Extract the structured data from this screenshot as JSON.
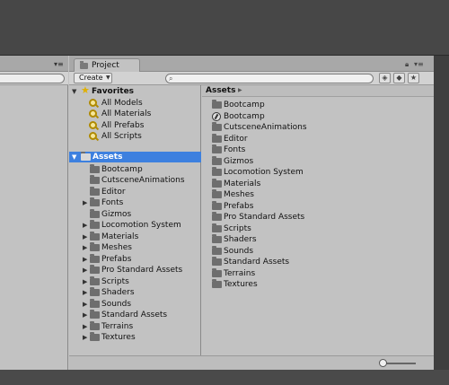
{
  "project_window": {
    "tab_label": "Project",
    "lock_icon": "lock-icon",
    "menu_icon": "menu-icon",
    "create_label": "Create",
    "search_value": "",
    "toolbar_icons": [
      "filter-type-icon",
      "filter-label-icon",
      "star-icon"
    ]
  },
  "tree": {
    "favorites": {
      "label": "Favorites",
      "items": [
        "All Models",
        "All Materials",
        "All Prefabs",
        "All Scripts"
      ]
    },
    "assets": {
      "label": "Assets",
      "children": [
        {
          "label": "Bootcamp",
          "expandable": false
        },
        {
          "label": "CutsceneAnimations",
          "expandable": false
        },
        {
          "label": "Editor",
          "expandable": false
        },
        {
          "label": "Fonts",
          "expandable": true
        },
        {
          "label": "Gizmos",
          "expandable": false
        },
        {
          "label": "Locomotion System",
          "expandable": true
        },
        {
          "label": "Materials",
          "expandable": true
        },
        {
          "label": "Meshes",
          "expandable": true
        },
        {
          "label": "Prefabs",
          "expandable": true
        },
        {
          "label": "Pro Standard Assets",
          "expandable": true
        },
        {
          "label": "Scripts",
          "expandable": true
        },
        {
          "label": "Shaders",
          "expandable": true
        },
        {
          "label": "Sounds",
          "expandable": true
        },
        {
          "label": "Standard Assets",
          "expandable": true
        },
        {
          "label": "Terrains",
          "expandable": true
        },
        {
          "label": "Textures",
          "expandable": true
        }
      ]
    }
  },
  "content": {
    "breadcrumb": "Assets",
    "items": [
      {
        "label": "Bootcamp",
        "icon": "folder-icon"
      },
      {
        "label": "Bootcamp",
        "icon": "unity-scene-icon"
      },
      {
        "label": "CutsceneAnimations",
        "icon": "folder-icon"
      },
      {
        "label": "Editor",
        "icon": "folder-icon"
      },
      {
        "label": "Fonts",
        "icon": "folder-icon"
      },
      {
        "label": "Gizmos",
        "icon": "folder-icon"
      },
      {
        "label": "Locomotion System",
        "icon": "folder-icon"
      },
      {
        "label": "Materials",
        "icon": "folder-icon"
      },
      {
        "label": "Meshes",
        "icon": "folder-icon"
      },
      {
        "label": "Prefabs",
        "icon": "folder-icon"
      },
      {
        "label": "Pro Standard Assets",
        "icon": "folder-icon"
      },
      {
        "label": "Scripts",
        "icon": "folder-icon"
      },
      {
        "label": "Shaders",
        "icon": "folder-icon"
      },
      {
        "label": "Sounds",
        "icon": "folder-icon"
      },
      {
        "label": "Standard Assets",
        "icon": "folder-icon"
      },
      {
        "label": "Terrains",
        "icon": "folder-icon"
      },
      {
        "label": "Textures",
        "icon": "folder-icon"
      }
    ]
  },
  "icon_size_slider": 0.0
}
